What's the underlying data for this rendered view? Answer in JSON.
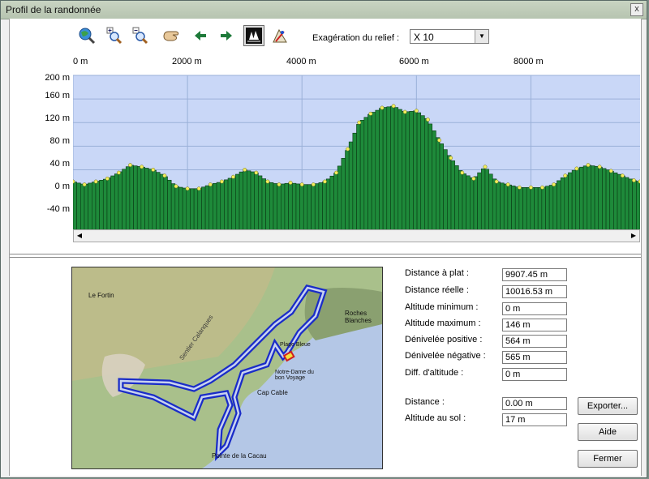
{
  "window": {
    "title": "Profil de la randonnée",
    "close_label": "x"
  },
  "toolbar": {
    "buttons": [
      "globe-icon",
      "zoom-in-icon",
      "zoom-out-icon",
      "pan-hand-icon",
      "arrow-left-icon",
      "arrow-right-icon",
      "forest-profile-icon",
      "hiker-map-icon"
    ],
    "exag_label": "Exagération du relief :",
    "exag_value": "X 10"
  },
  "chart_data": {
    "type": "bar",
    "xlabel": "",
    "ylabel": "",
    "x_ticks": [
      "0 m",
      "2000 m",
      "4000 m",
      "6000 m",
      "8000 m"
    ],
    "y_ticks": [
      "200 m",
      "160 m",
      "120 m",
      "80 m",
      "40 m",
      "0 m",
      "-40 m"
    ],
    "xlim": [
      0,
      9907.45
    ],
    "ylim": [
      -72,
      200
    ],
    "grid": true,
    "colors": {
      "bar": "#1e8a3a",
      "bar_edge": "#0a3a14",
      "point": "#f3ee5c",
      "background": "#c9d7f7",
      "grid": "#9ab0d8"
    },
    "x": [
      0,
      200,
      400,
      600,
      800,
      1000,
      1200,
      1400,
      1600,
      1800,
      2000,
      2200,
      2400,
      2600,
      2800,
      3000,
      3200,
      3400,
      3600,
      3800,
      4000,
      4200,
      4400,
      4600,
      4800,
      5000,
      5200,
      5400,
      5600,
      5800,
      6000,
      6200,
      6400,
      6600,
      6800,
      7000,
      7200,
      7400,
      7600,
      7800,
      8000,
      8200,
      8400,
      8600,
      8800,
      9000,
      9200,
      9400,
      9600,
      9800,
      9907
    ],
    "values": [
      20,
      15,
      20,
      25,
      35,
      48,
      45,
      40,
      30,
      12,
      8,
      8,
      15,
      20,
      28,
      40,
      35,
      20,
      15,
      18,
      15,
      15,
      20,
      35,
      75,
      120,
      135,
      145,
      148,
      138,
      140,
      125,
      90,
      60,
      35,
      25,
      45,
      20,
      15,
      10,
      10,
      10,
      15,
      30,
      42,
      48,
      45,
      38,
      30,
      22,
      20
    ]
  },
  "map": {
    "labels": [
      "Pointe de la Cacau",
      "Cap Cable",
      "Roches Blanches",
      "Notre-Dame du bon Voyage",
      "Plage Bleue",
      "Le Fortin",
      "Sentier Calanques"
    ],
    "colors": {
      "water": "#b4c7e6",
      "land": "#a9c08b",
      "track": "#1a2cc8",
      "track_inner": "#c8d2f0"
    }
  },
  "stats": [
    {
      "label": "Distance à plat :",
      "value": "9907.45 m"
    },
    {
      "label": "Distance réelle :",
      "value": "10016.53 m"
    },
    {
      "label": "Altitude minimum :",
      "value": "0 m"
    },
    {
      "label": "Altitude maximum :",
      "value": "146 m"
    },
    {
      "label": "Dénivelée positive :",
      "value": "564 m"
    },
    {
      "label": "Dénivelée négative :",
      "value": "565 m"
    },
    {
      "label": "Diff. d'altitude :",
      "value": "0 m"
    }
  ],
  "cursor": [
    {
      "label": "Distance :",
      "value": "0.00 m"
    },
    {
      "label": "Altitude au sol :",
      "value": "17 m"
    }
  ],
  "buttons": {
    "export": "Exporter...",
    "help": "Aide",
    "close": "Fermer"
  }
}
